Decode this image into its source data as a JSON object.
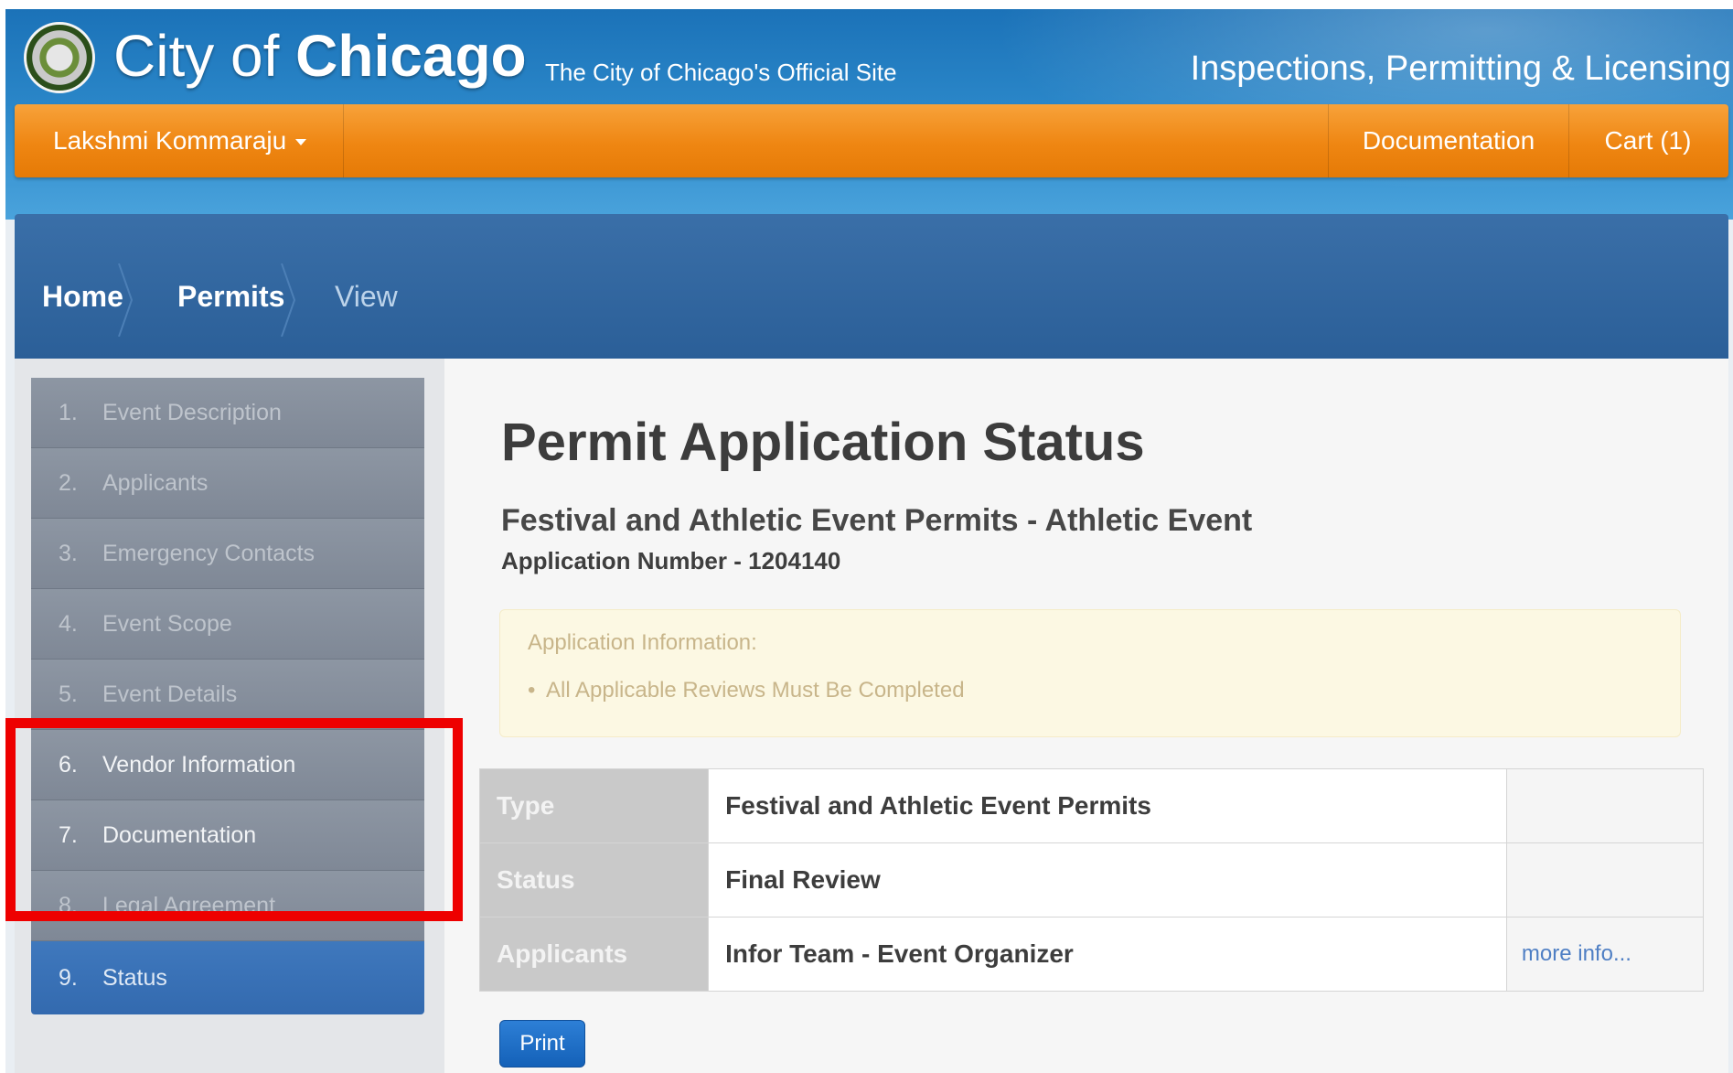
{
  "header": {
    "logo_prefix": "City of ",
    "logo_bold": "Chicago",
    "tagline": "The City of Chicago's Official Site",
    "section_title": "Inspections, Permitting & Licensing"
  },
  "navbar": {
    "user_name": "Lakshmi Kommaraju",
    "documentation": "Documentation",
    "cart": "Cart (1)"
  },
  "breadcrumb": [
    "Home",
    "Permits",
    "View"
  ],
  "steps": [
    {
      "num": "1.",
      "label": "Event Description"
    },
    {
      "num": "2.",
      "label": "Applicants"
    },
    {
      "num": "3.",
      "label": "Emergency Contacts"
    },
    {
      "num": "4.",
      "label": "Event Scope"
    },
    {
      "num": "5.",
      "label": "Event Details"
    },
    {
      "num": "6.",
      "label": "Vendor Information"
    },
    {
      "num": "7.",
      "label": "Documentation"
    },
    {
      "num": "8.",
      "label": "Legal Agreement"
    },
    {
      "num": "9.",
      "label": "Status"
    }
  ],
  "main": {
    "title": "Permit Application Status",
    "subtitle": "Festival and Athletic Event Permits - Athletic Event",
    "application_number": "Application Number - 1204140",
    "alert": {
      "heading": "Application Information:",
      "items": [
        "All Applicable Reviews Must Be Completed"
      ]
    },
    "table": [
      {
        "label": "Type",
        "value": "Festival and Athletic Event Permits",
        "action": ""
      },
      {
        "label": "Status",
        "value": "Final Review",
        "action": ""
      },
      {
        "label": "Applicants",
        "value": "Infor Team - Event Organizer",
        "action": "more info..."
      }
    ],
    "print_label": "Print"
  },
  "colors": {
    "navbar_orange": "#ef8612",
    "header_blue": "#1b72b8",
    "breadcrumb_blue": "#2b5f98",
    "active_step": "#336aaf",
    "highlight_red": "#ee0000"
  }
}
